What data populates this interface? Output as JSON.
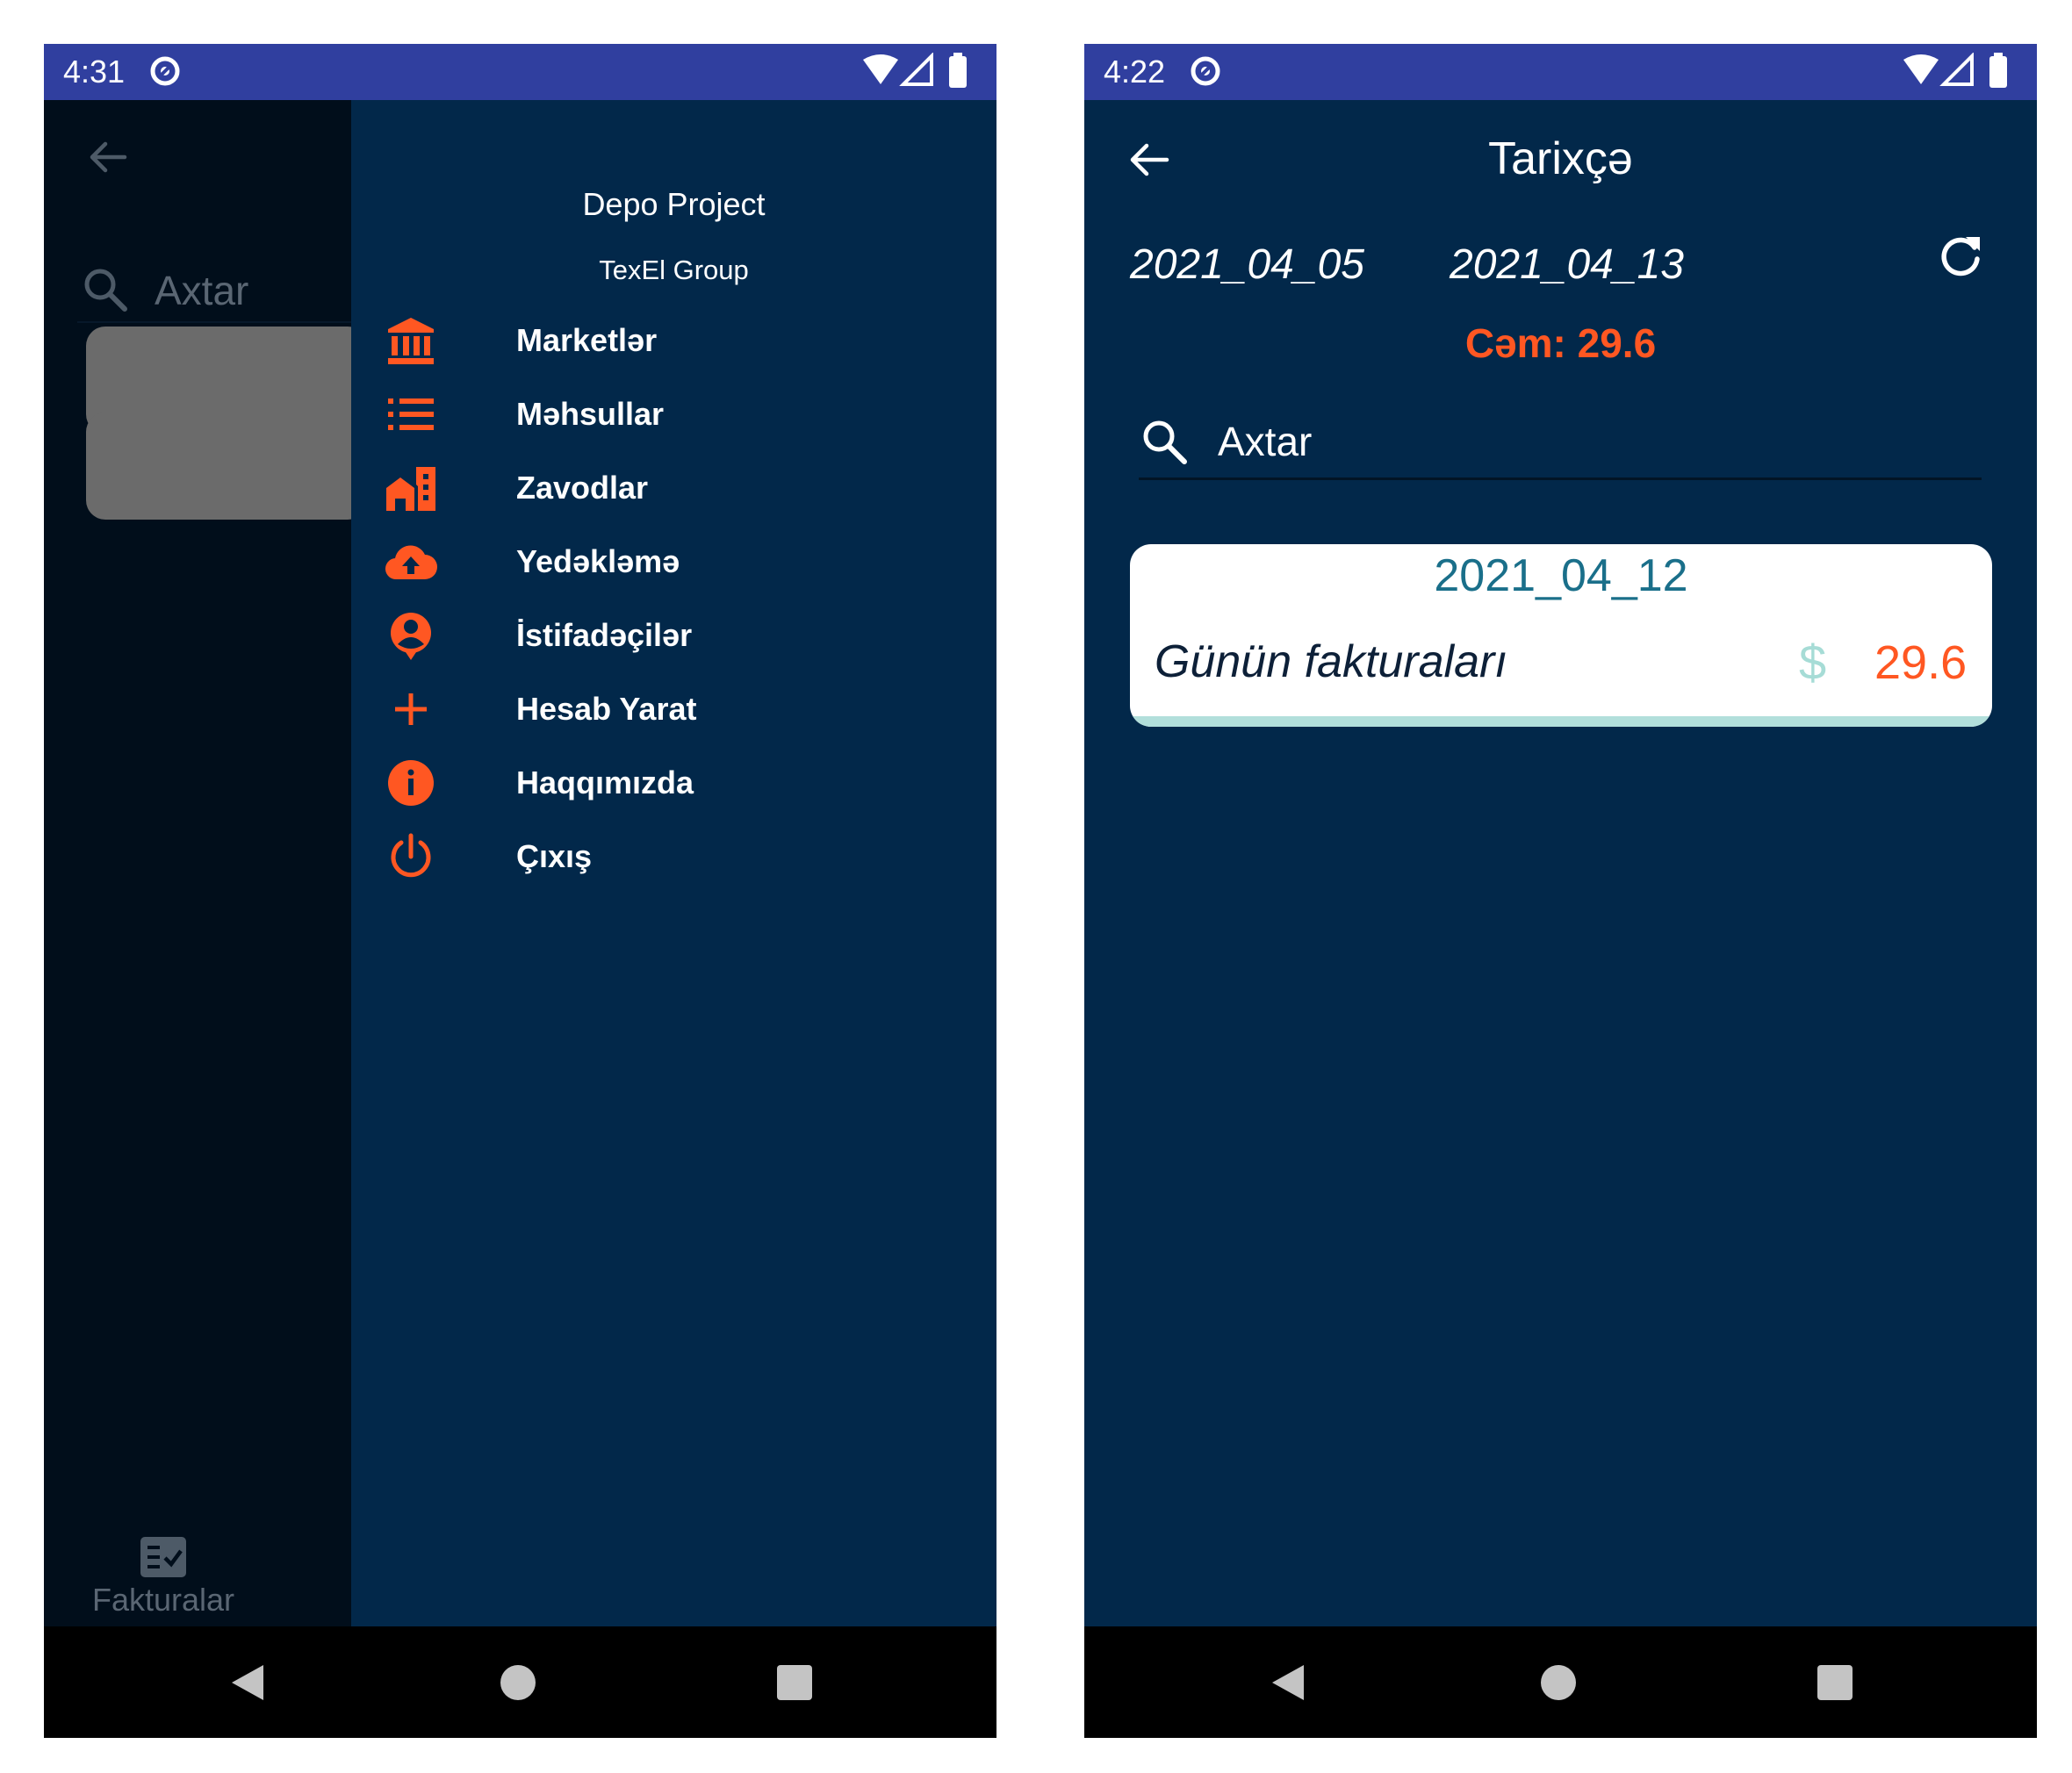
{
  "left_screen": {
    "status": {
      "time": "4:31"
    },
    "background_app": {
      "search_placeholder": "Axtar",
      "tab_label": "Fakturalar"
    },
    "drawer": {
      "title": "Depo Project",
      "subtitle": "TexEl Group",
      "items": [
        {
          "label": "Marketlər",
          "icon": "bank-icon"
        },
        {
          "label": "Məhsullar",
          "icon": "list-icon"
        },
        {
          "label": "Zavodlar",
          "icon": "factory-icon"
        },
        {
          "label": "Yedəkləmə",
          "icon": "cloud-upload-icon"
        },
        {
          "label": "İstifadəçilər",
          "icon": "user-pin-icon"
        },
        {
          "label": "Hesab Yarat",
          "icon": "plus-icon"
        },
        {
          "label": "Haqqımızda",
          "icon": "info-icon"
        },
        {
          "label": "Çıxış",
          "icon": "power-icon"
        }
      ]
    }
  },
  "right_screen": {
    "status": {
      "time": "4:22"
    },
    "title": "Tarixçə",
    "date_from": "2021_04_05",
    "date_to": "2021_04_13",
    "sum_label": "Cəm: 29.6",
    "search_placeholder": "Axtar",
    "card": {
      "date": "2021_04_12",
      "label": "Günün fakturaları",
      "currency": "$",
      "amount": "29.6"
    }
  },
  "colors": {
    "status_bar": "#303f9f",
    "background": "#02284a",
    "accent": "#ff5722",
    "nav_bar": "#000000"
  }
}
